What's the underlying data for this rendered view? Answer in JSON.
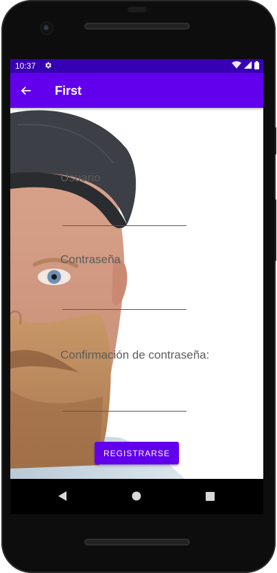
{
  "status_bar": {
    "time": "10:37",
    "icons": [
      "settings-gear-icon",
      "wifi-icon",
      "signal-icon",
      "battery-icon"
    ],
    "background_color": "#3700b3"
  },
  "app_bar": {
    "title": "First",
    "back_icon": "arrow-back-icon",
    "background_color": "#6200ee"
  },
  "form": {
    "usuario_label": "Usuario",
    "usuario_value": "",
    "contrasena_label": "Contraseña",
    "contrasena_value": "",
    "confirmacion_label": "Confirmación de contraseña:",
    "confirmacion_value": "",
    "register_button_label": "REGISTRARSE",
    "button_color": "#6200ee"
  },
  "nav_bar": {
    "items": [
      "back-triangle-icon",
      "home-circle-icon",
      "recents-square-icon"
    ]
  }
}
